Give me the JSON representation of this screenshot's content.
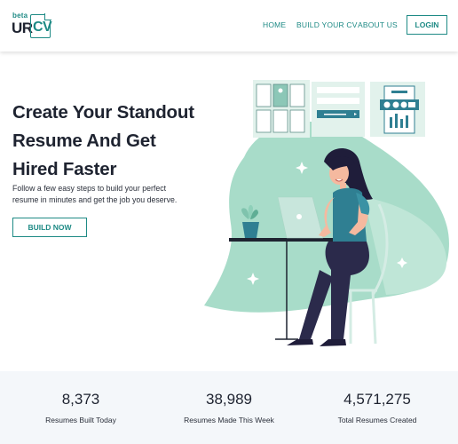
{
  "logo": {
    "beta": "beta",
    "ur": "UR",
    "cv": "CV"
  },
  "nav": {
    "home": "HOME",
    "build": "BUILD YOUR CV",
    "about": "ABOUT US",
    "login": "LOGIN"
  },
  "hero": {
    "title": "Create Your Standout Resume And Get Hired Faster",
    "subtitle": "Follow a few easy steps to build your perfect resume in minutes and get the job you deserve.",
    "cta": "BUILD NOW"
  },
  "stats": [
    {
      "value": "8,373",
      "label": "Resumes Built Today"
    },
    {
      "value": "38,989",
      "label": "Resumes Made This Week"
    },
    {
      "value": "4,571,275",
      "label": "Total Resumes Created"
    }
  ],
  "colors": {
    "accent": "#1e8a85",
    "mint": "#a8dcc9",
    "text": "#1e2330",
    "stats_bg": "#f4f7fa"
  }
}
